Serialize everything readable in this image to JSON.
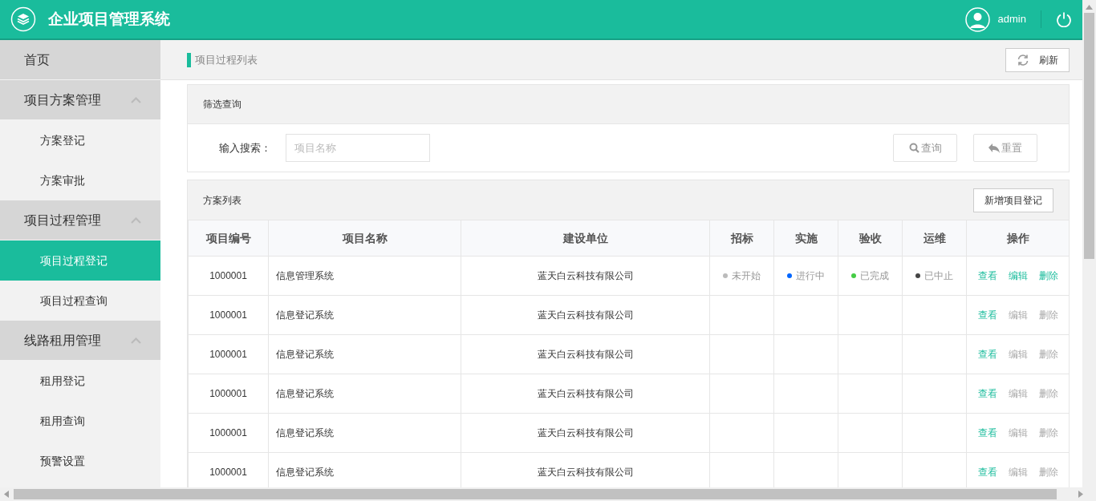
{
  "header": {
    "title": "企业项目管理系统",
    "user": "admin"
  },
  "sidebar": {
    "items": [
      {
        "label": "首页",
        "kind": "link"
      },
      {
        "label": "项目方案管理",
        "kind": "group",
        "expanded": true,
        "children": [
          {
            "label": "方案登记",
            "selected": false
          },
          {
            "label": "方案审批",
            "selected": false
          }
        ]
      },
      {
        "label": "项目过程管理",
        "kind": "group",
        "expanded": true,
        "children": [
          {
            "label": "项目过程登记",
            "selected": true
          },
          {
            "label": "项目过程查询",
            "selected": false
          }
        ]
      },
      {
        "label": "线路租用管理",
        "kind": "group",
        "expanded": true,
        "children": [
          {
            "label": "租用登记",
            "selected": false
          },
          {
            "label": "租用查询",
            "selected": false
          },
          {
            "label": "预警设置",
            "selected": false
          }
        ]
      }
    ]
  },
  "breadcrumb": "项目过程列表",
  "refresh_button": "刷新",
  "filter": {
    "title": "筛选查询",
    "label": "输入搜索：",
    "placeholder": "项目名称",
    "search_button": "查询",
    "reset_button": "重置"
  },
  "table": {
    "title": "方案列表",
    "add_button": "新增项目登记",
    "columns": [
      "项目编号",
      "项目名称",
      "建设单位",
      "招标",
      "实施",
      "验收",
      "运维",
      "操作"
    ],
    "rows": [
      {
        "id": "1000001",
        "name": "信息管理系统",
        "unit": "蓝天白云科技有限公司",
        "statuses": [
          {
            "text": "未开始",
            "color": "#bbbbbb"
          },
          {
            "text": "进行中",
            "color": "#0066ff"
          },
          {
            "text": "已完成",
            "color": "#44cc44"
          },
          {
            "text": "已中止",
            "color": "#444444"
          }
        ],
        "actions": [
          {
            "label": "查看",
            "disabled": false
          },
          {
            "label": "编辑",
            "disabled": false
          },
          {
            "label": "删除",
            "disabled": false
          }
        ]
      },
      {
        "id": "1000001",
        "name": "信息登记系统",
        "unit": "蓝天白云科技有限公司",
        "statuses": [],
        "actions": [
          {
            "label": "查看",
            "disabled": false
          },
          {
            "label": "编辑",
            "disabled": true
          },
          {
            "label": "删除",
            "disabled": true
          }
        ]
      },
      {
        "id": "1000001",
        "name": "信息登记系统",
        "unit": "蓝天白云科技有限公司",
        "statuses": [],
        "actions": [
          {
            "label": "查看",
            "disabled": false
          },
          {
            "label": "编辑",
            "disabled": true
          },
          {
            "label": "删除",
            "disabled": true
          }
        ]
      },
      {
        "id": "1000001",
        "name": "信息登记系统",
        "unit": "蓝天白云科技有限公司",
        "statuses": [],
        "actions": [
          {
            "label": "查看",
            "disabled": false
          },
          {
            "label": "编辑",
            "disabled": true
          },
          {
            "label": "删除",
            "disabled": true
          }
        ]
      },
      {
        "id": "1000001",
        "name": "信息登记系统",
        "unit": "蓝天白云科技有限公司",
        "statuses": [],
        "actions": [
          {
            "label": "查看",
            "disabled": false
          },
          {
            "label": "编辑",
            "disabled": true
          },
          {
            "label": "删除",
            "disabled": true
          }
        ]
      },
      {
        "id": "1000001",
        "name": "信息登记系统",
        "unit": "蓝天白云科技有限公司",
        "statuses": [],
        "actions": [
          {
            "label": "查看",
            "disabled": false
          },
          {
            "label": "编辑",
            "disabled": true
          },
          {
            "label": "删除",
            "disabled": true
          }
        ]
      }
    ]
  }
}
